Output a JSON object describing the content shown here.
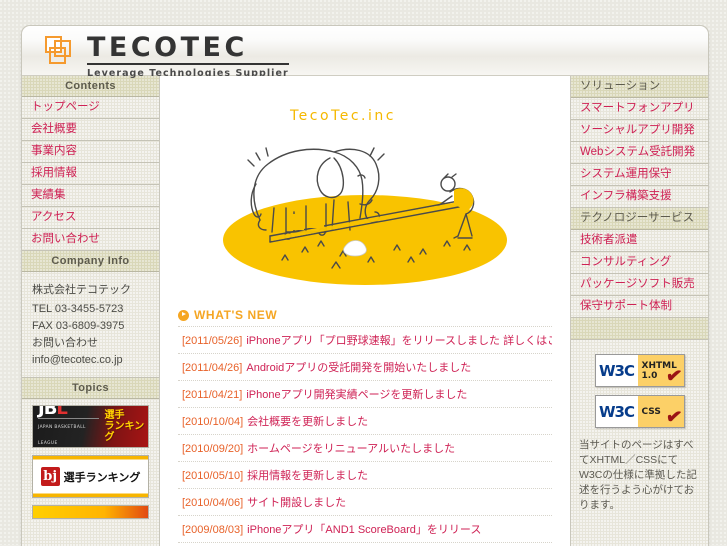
{
  "site": {
    "logo_word": "TECOTEC",
    "logo_tagline": "Leverage Technologies Supplier",
    "hero_caption": "TecoTec.inc"
  },
  "left_sidebar": {
    "contents_header": "Contents",
    "nav_items": [
      {
        "label": "トップページ"
      },
      {
        "label": "会社概要"
      },
      {
        "label": "事業内容"
      },
      {
        "label": "採用情報"
      },
      {
        "label": "実績集"
      },
      {
        "label": "アクセス"
      },
      {
        "label": "お問い合わせ"
      }
    ],
    "company_header": "Company Info",
    "company": {
      "name": "株式会社テコテック",
      "tel_label": "TEL",
      "tel": "03-3455-5723",
      "fax_label": "FAX",
      "fax": "03-6809-3975",
      "contact_label": "お問い合わせ",
      "email": "info@tecotec.co.jp"
    },
    "topics_header": "Topics",
    "banners": [
      {
        "name": "jbl-ranking-banner",
        "brand": "JB",
        "brand_accent": "L",
        "sub": "JAPAN BASKETBALL LEAGUE",
        "jp_line1": "選手",
        "jp_line2": "ランキング"
      },
      {
        "name": "bj-ranking-banner",
        "brand": "bj",
        "jp": "選手ランキング"
      },
      {
        "name": "third-banner",
        "jp": ""
      }
    ]
  },
  "main": {
    "whats_new_title": "WHAT'S NEW",
    "whats_new_icon": "circle-play-icon",
    "news": [
      {
        "date": "[2011/05/26]",
        "text": "iPhoneアプリ「プロ野球速報」をリリースしました 詳しくはこちらをご覧下さい"
      },
      {
        "date": "[2011/04/26]",
        "text": "Androidアプリの受託開発を開始いたしました"
      },
      {
        "date": "[2011/04/21]",
        "text": "iPhoneアプリ開発実績ページを更新しました"
      },
      {
        "date": "[2010/10/04]",
        "text": "会社概要を更新しました"
      },
      {
        "date": "[2010/09/20]",
        "text": "ホームページをリニューアルいたしました"
      },
      {
        "date": "[2010/05/10]",
        "text": "採用情報を更新しました"
      },
      {
        "date": "[2010/04/06]",
        "text": "サイト開設しました"
      },
      {
        "date": "[2009/08/03]",
        "text": "iPhoneアプリ「AND1 ScoreBoard」をリリース"
      }
    ]
  },
  "right_sidebar": {
    "sections": [
      {
        "header": "ソリューション",
        "items": [
          {
            "label": "スマートフォンアプリ"
          },
          {
            "label": "ソーシャルアプリ開発"
          },
          {
            "label": "Webシステム受託開発"
          },
          {
            "label": "システム運用保守"
          },
          {
            "label": "インフラ構築支援"
          }
        ]
      },
      {
        "header": "テクノロジーサービス",
        "items": [
          {
            "label": "技術者派遣"
          },
          {
            "label": "コンサルティング"
          },
          {
            "label": "パッケージソフト販売"
          },
          {
            "label": "保守サポート体制"
          }
        ]
      }
    ],
    "w3c": {
      "badges": [
        {
          "left": "W3C",
          "line1": "XHTML",
          "line2": "1.0",
          "tick": "✔"
        },
        {
          "left": "W3C",
          "line1": "CSS",
          "line2": "",
          "tick": "✔"
        }
      ],
      "note": "当サイトのページはすべてXHTML／CSSにてW3Cの仕様に準拠した記述を行うよう心がけております。"
    }
  },
  "colors": {
    "accent_pink": "#cf2255",
    "accent_orange": "#e8622a",
    "header_olive": "#d9d7b8",
    "logo_orange": "#f59a2e",
    "hero_yellow": "#f9c300"
  }
}
